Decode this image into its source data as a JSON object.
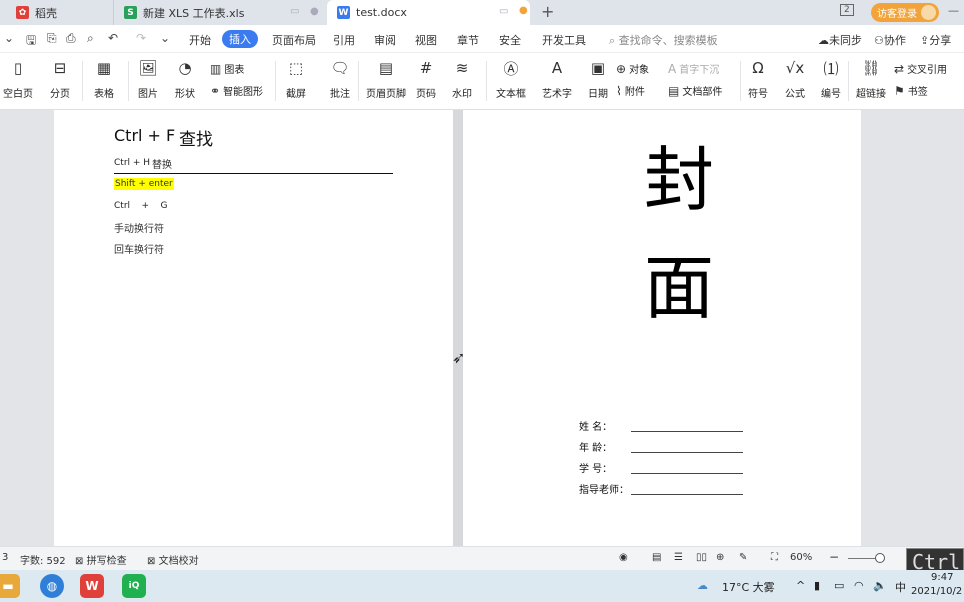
{
  "tabs": [
    {
      "label": "稻壳",
      "icon": "daoke-icon",
      "color": "#e0403a"
    },
    {
      "label": "新建 XLS 工作表.xls",
      "icon": "spreadsheet-icon",
      "color": "#2aa05a"
    },
    {
      "label": "test.docx",
      "icon": "writer-doc-icon",
      "color": "#3a7bf0"
    }
  ],
  "tabbar": {
    "new_tab": "+",
    "login": "访客登录",
    "page_indicator": "2"
  },
  "menu": {
    "items": [
      "开始",
      "插入",
      "页面布局",
      "引用",
      "审阅",
      "视图",
      "章节",
      "安全",
      "开发工具"
    ],
    "active": "插入",
    "search_placeholder": "查找命令、搜索模板",
    "right": [
      "未同步",
      "协作",
      "分享"
    ]
  },
  "ribbon": {
    "blank_page": "空白页",
    "page_break": "分页",
    "table": "表格",
    "picture": "图片",
    "shape": "形状",
    "chart": "图表",
    "smart_shape": "智能图形",
    "screenshot": "截屏",
    "comment": "批注",
    "header_footer": "页眉页脚",
    "page_number": "页码",
    "watermark": "水印",
    "textbox": "文本框",
    "wordart": "艺术字",
    "date": "日期",
    "object": "对象",
    "dropcap": "首字下沉",
    "attachment": "附件",
    "doc_parts": "文档部件",
    "symbol": "符号",
    "formula": "公式",
    "numbering": "编号",
    "cross_ref": "交叉引用",
    "hyperlink": "超链接",
    "bookmark": "书签"
  },
  "left_page": {
    "title_shortcut": "Ctrl + F",
    "title_label": "查找",
    "line1_shortcut": "Ctrl + H",
    "line1_label": "替换",
    "highlight": "Shift + enter",
    "goto": "Ctrl    +    G",
    "manual_break": "手动换行符",
    "enter_break": "回车换行符"
  },
  "right_page": {
    "cover_char1": "封",
    "cover_char2": "面",
    "fields": [
      "姓      名：",
      "年      龄：",
      "学      号：",
      "指导老师："
    ]
  },
  "status": {
    "page": "3",
    "word_count": "字数: 592",
    "spell_check": "拼写检查",
    "proofread": "文档校对",
    "zoom": "60%",
    "ctrl_overlay": "Ctrl"
  },
  "taskbar": {
    "weather": "17°C 大雾",
    "ime": "中",
    "time": "9:47",
    "date": "2021/10/2"
  }
}
